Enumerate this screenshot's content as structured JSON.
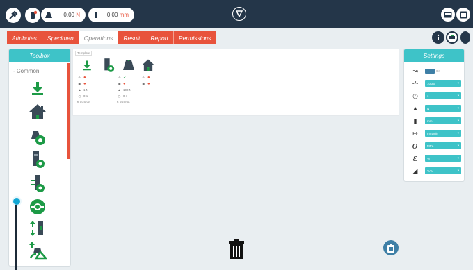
{
  "topbar": {
    "force_value": "0.00",
    "force_unit": "N",
    "length_value": "0.00",
    "length_unit": "mm"
  },
  "tabs": [
    "Attributes",
    "Specimen",
    "Operations",
    "Result",
    "Report",
    "Permissions"
  ],
  "active_tab": "Operations",
  "toolbox": {
    "title": "Toolbox",
    "section": "- Common",
    "items": [
      "download-arrow-icon",
      "home-icon",
      "weight-circle-icon",
      "specimen-block-icon",
      "clamp-block-icon",
      "green-target-icon",
      "up-down-bar-icon",
      "cycle-weight-icon"
    ]
  },
  "template": {
    "label": "Template",
    "columns": [
      {
        "rows": [
          "rate",
          "block",
          "weight",
          "timer",
          "note"
        ],
        "weight_text": "1 N",
        "timer_text": "0 s",
        "note_text": "5 ms/mm"
      },
      {
        "rows": [
          "rate",
          "block",
          "weight",
          "timer",
          "note"
        ],
        "weight_text": "100 N",
        "timer_text": "0 s",
        "note_text": "5 ms/mm"
      },
      {
        "rows": [
          "rate",
          "block"
        ]
      }
    ]
  },
  "settings": {
    "title": "Settings",
    "rows": [
      {
        "icon": "rate-icon",
        "value": "On"
      },
      {
        "icon": "speed-icon",
        "value": "100/0"
      },
      {
        "icon": "timer-icon",
        "value": "s"
      },
      {
        "icon": "weight-icon",
        "value": "N"
      },
      {
        "icon": "length-icon",
        "value": "mm"
      },
      {
        "icon": "direction-icon",
        "value": "mm/min"
      },
      {
        "icon": "sigma-icon",
        "value": "MPa"
      },
      {
        "icon": "epsilon-icon",
        "value": "%"
      },
      {
        "icon": "shape-icon",
        "value": "%%"
      }
    ]
  },
  "colors": {
    "topbar": "#243649",
    "accent_orange": "#e8533c",
    "teal": "#3ec3c8",
    "green": "#1c9a46",
    "dark": "#243649"
  }
}
